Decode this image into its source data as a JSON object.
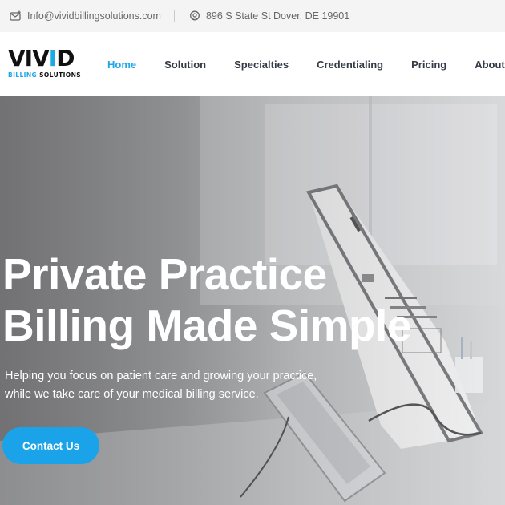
{
  "topbar": {
    "email": "Info@vividbillingsolutions.com",
    "email_icon": "mail-icon",
    "address": "896 S State St Dover, DE 19901",
    "address_icon": "location-pin-icon"
  },
  "logo": {
    "word_prefix": "VIV",
    "word_accent": "I",
    "word_suffix": "D",
    "sub_accent": "BILLING",
    "sub_rest": "SOLUTIONS"
  },
  "nav": {
    "items": [
      {
        "label": "Home",
        "active": true
      },
      {
        "label": "Solution"
      },
      {
        "label": "Specialties"
      },
      {
        "label": "Credentialing"
      },
      {
        "label": "Pricing"
      },
      {
        "label": "About Us"
      }
    ]
  },
  "hero": {
    "title_line1": "Private Practice",
    "title_line2": "Billing Made Simple",
    "text_line1": "Helping you focus on patient care and growing your practice,",
    "text_line2": "while we take care of your medical billing service.",
    "cta_label": "Contact Us"
  },
  "colors": {
    "accent": "#1fa8e6",
    "nav_text": "#333a45",
    "topbar_bg": "#f4f4f4"
  }
}
